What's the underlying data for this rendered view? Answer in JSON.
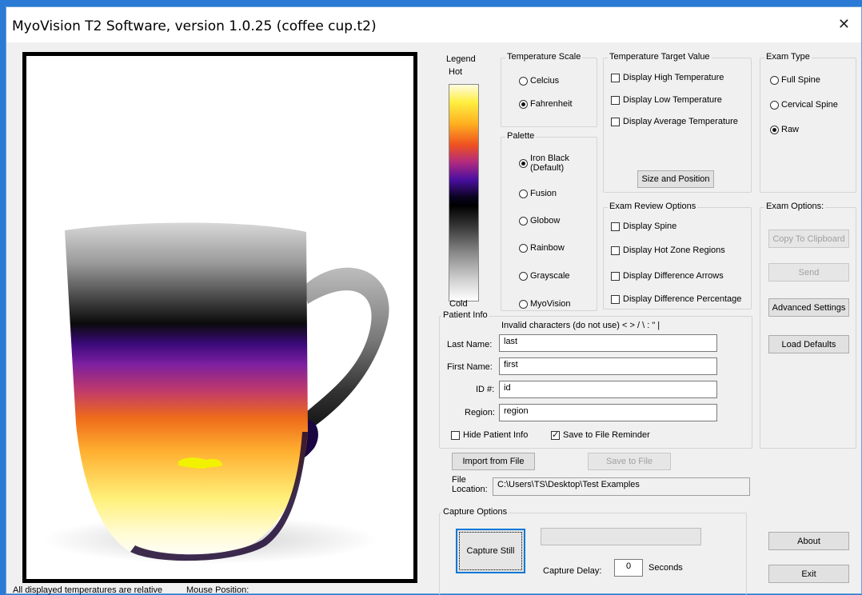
{
  "window": {
    "title": "MyoVision T2 Software, version 1.0.25  (coffee cup.t2)"
  },
  "legend": {
    "label": "Legend",
    "hot": "Hot",
    "cold": "Cold"
  },
  "temperature_scale": {
    "label": "Temperature Scale",
    "options": [
      {
        "label": "Celcius",
        "selected": false
      },
      {
        "label": "Fahrenheit",
        "selected": true
      }
    ]
  },
  "palette": {
    "label": "Palette",
    "options": [
      {
        "label": "Iron Black\n(Default)",
        "selected": true
      },
      {
        "label": "Fusion",
        "selected": false
      },
      {
        "label": "Globow",
        "selected": false
      },
      {
        "label": "Rainbow",
        "selected": false
      },
      {
        "label": "Grayscale",
        "selected": false
      },
      {
        "label": "MyoVision",
        "selected": false
      }
    ]
  },
  "target_value": {
    "label": "Temperature Target Value",
    "options": [
      {
        "label": "Display High Temperature",
        "checked": false
      },
      {
        "label": "Display Low Temperature",
        "checked": false
      },
      {
        "label": "Display Average Temperature",
        "checked": false
      }
    ],
    "size_button": "Size and Position"
  },
  "exam_type": {
    "label": "Exam Type",
    "options": [
      {
        "label": "Full Spine",
        "selected": false
      },
      {
        "label": "Cervical Spine",
        "selected": false
      },
      {
        "label": "Raw",
        "selected": true
      }
    ]
  },
  "review_options": {
    "label": "Exam Review Options",
    "options": [
      {
        "label": "Display Spine",
        "checked": false
      },
      {
        "label": "Display Hot Zone Regions",
        "checked": false
      },
      {
        "label": "Display Difference Arrows",
        "checked": false
      },
      {
        "label": "Display Difference Percentage",
        "checked": false
      }
    ]
  },
  "exam_options": {
    "label": "Exam Options:",
    "copy": "Copy To Clipboard",
    "send": "Send",
    "advanced": "Advanced Settings",
    "defaults": "Load Defaults"
  },
  "patient": {
    "label": "Patient Info",
    "invalid": "Invalid characters (do not use)  <  >  /  \\  :  \"  |",
    "last_label": "Last Name:",
    "last": "last",
    "first_label": "First Name:",
    "first": "first",
    "id_label": "ID #:",
    "id": "id",
    "region_label": "Region:",
    "region": "region",
    "hide": "Hide Patient Info",
    "hide_checked": false,
    "reminder": "Save to File Reminder",
    "reminder_checked": true
  },
  "file": {
    "import": "Import from File",
    "save": "Save to File",
    "location_label": "File\nLocation:",
    "location": "C:\\Users\\TS\\Desktop\\Test Examples"
  },
  "capture": {
    "label": "Capture Options",
    "still": "Capture Still",
    "delay_label": "Capture Delay:",
    "delay": "0",
    "seconds": "Seconds"
  },
  "about": "About",
  "exit": "Exit",
  "status": {
    "relative": "All displayed temperatures are relative",
    "mouse": "Mouse Position:"
  },
  "colors": {
    "hot": "#ffff60",
    "mid": "#e8700a",
    "cool": "#4a0fa0",
    "cold": "#000000",
    "title_bar_accent": "#2b7bd6"
  }
}
